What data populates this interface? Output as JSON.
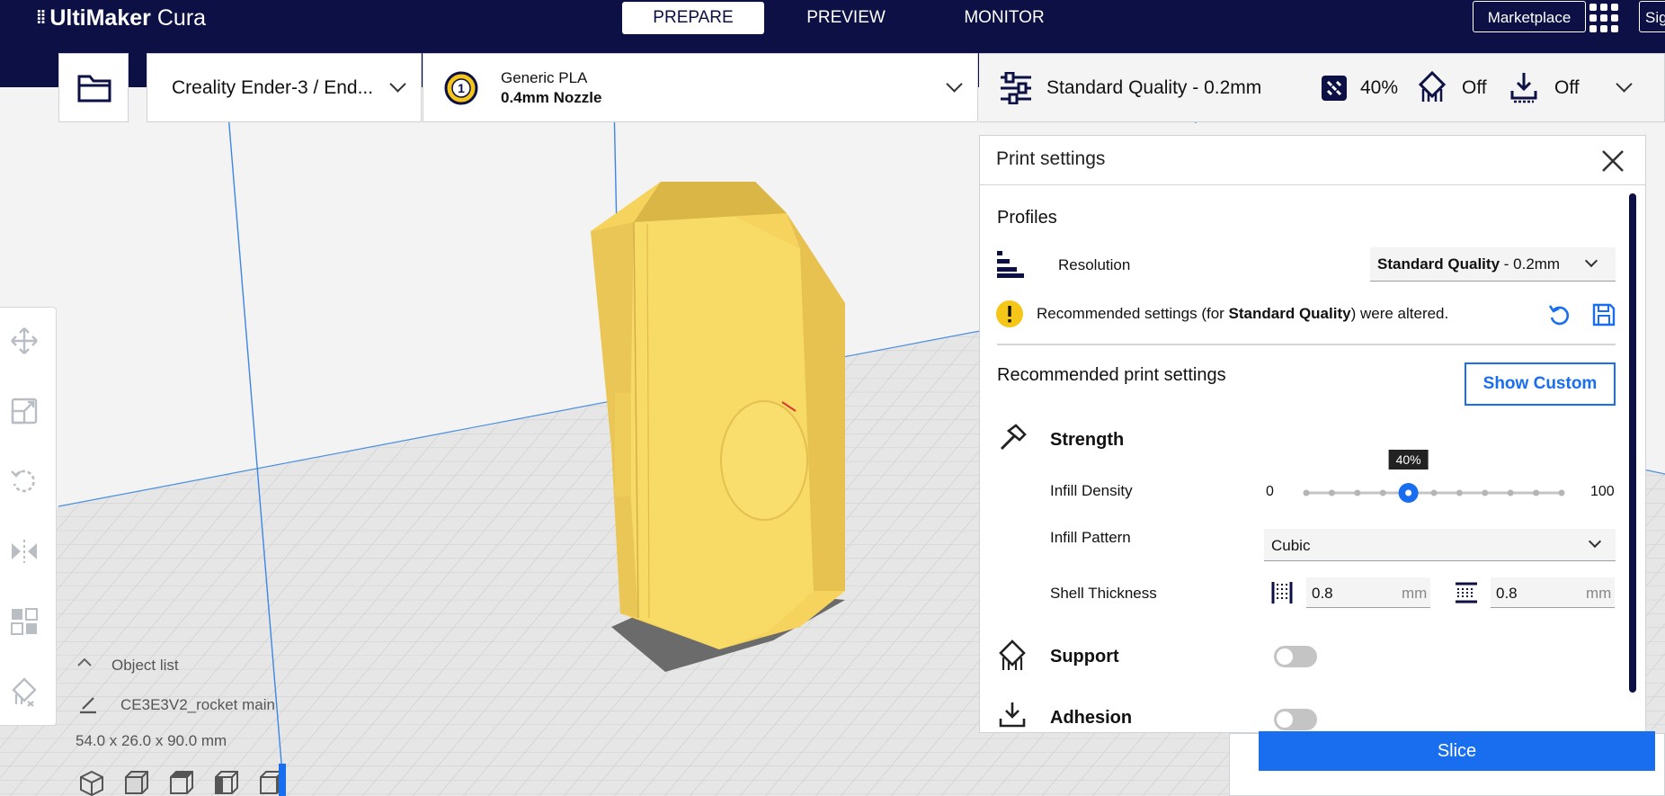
{
  "app": {
    "brand_name": "UltiMaker",
    "brand_product": "Cura"
  },
  "stages": [
    "PREPARE",
    "PREVIEW",
    "MONITOR"
  ],
  "topbar": {
    "marketplace": "Marketplace",
    "signin": "Sig"
  },
  "header": {
    "printer": "Creality Ender-3 / End...",
    "extruder_number": "1",
    "material": "Generic PLA",
    "nozzle": "0.4mm Nozzle",
    "quality": "Standard Quality - 0.2mm",
    "infill": "40%",
    "support": "Off",
    "adhesion": "Off"
  },
  "panel": {
    "title": "Print settings",
    "profiles_label": "Profiles",
    "resolution_label": "Resolution",
    "resolution_value_bold": "Standard Quality",
    "resolution_value_rest": " - 0.2mm",
    "warning_pre": "Recommended settings (for ",
    "warning_bold": "Standard Quality",
    "warning_post": ") were altered.",
    "recommended_label": "Recommended print settings",
    "show_custom": "Show Custom",
    "strength_label": "Strength",
    "infill_density_label": "Infill Density",
    "slider_min": "0",
    "slider_max": "100",
    "slider_value_label": "40%",
    "slider_value": 40,
    "infill_pattern_label": "Infill Pattern",
    "infill_pattern_value": "Cubic",
    "shell_thickness_label": "Shell Thickness",
    "wall_thickness": "0.8",
    "top_bottom_thickness": "0.8",
    "unit": "mm",
    "support_label": "Support",
    "support_enabled": false,
    "adhesion_label": "Adhesion",
    "adhesion_enabled": false
  },
  "object_list": {
    "label": "Object list",
    "object_name": "CE3E3V2_rocket main",
    "dimensions": "54.0 x 26.0 x 90.0 mm"
  },
  "slice": {
    "button": "Slice"
  },
  "colors": {
    "navy": "#0c1044",
    "blue": "#196ef0",
    "model_yellow": "#f5d35c",
    "warning": "#f5c518"
  }
}
